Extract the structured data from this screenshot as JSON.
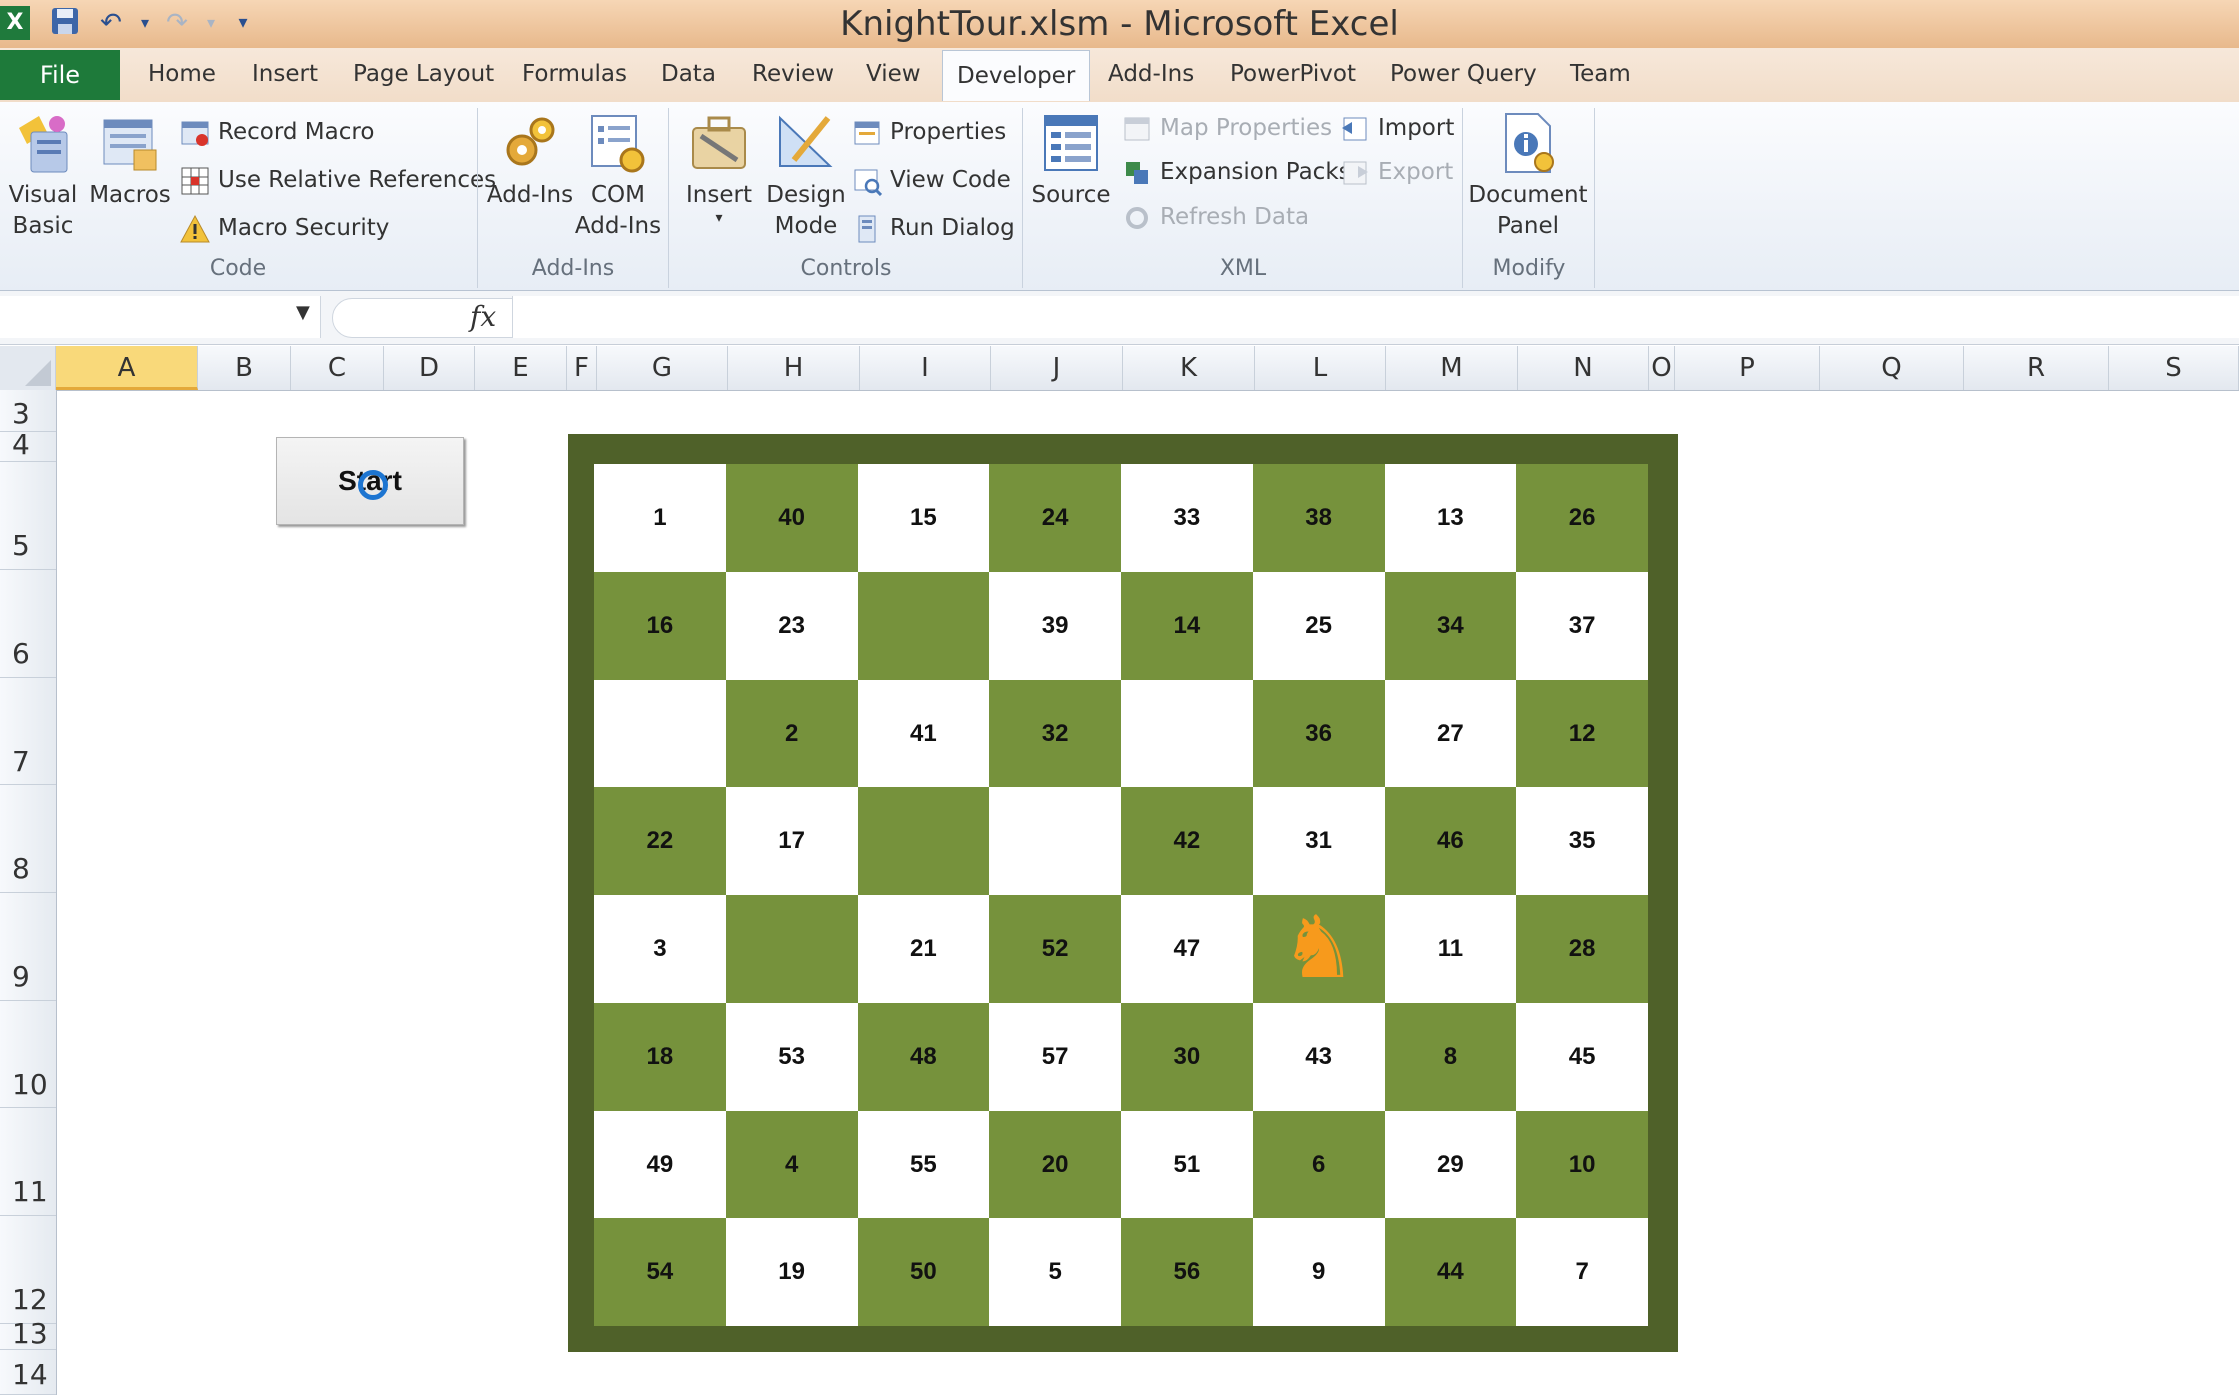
{
  "window": {
    "title": "KnightTour.xlsm  -  Microsoft Excel"
  },
  "quick_access": {
    "excel_icon": "excel-icon",
    "save_icon": "save-icon",
    "undo_icon": "undo-icon",
    "redo_icon": "redo-icon",
    "customize_icon": "customize-icon"
  },
  "tabs": [
    "File",
    "Home",
    "Insert",
    "Page Layout",
    "Formulas",
    "Data",
    "Review",
    "View",
    "Developer",
    "Add-Ins",
    "PowerPivot",
    "Power Query",
    "Team"
  ],
  "active_tab": "Developer",
  "ribbon": {
    "code": {
      "label": "Code",
      "visual_basic": [
        "Visual",
        "Basic"
      ],
      "macros": "Macros",
      "record_macro": "Record Macro",
      "use_relative": "Use Relative References",
      "macro_security": "Macro Security"
    },
    "addins": {
      "label": "Add-Ins",
      "addins": "Add-Ins",
      "com_addins": [
        "COM",
        "Add-Ins"
      ]
    },
    "controls": {
      "label": "Controls",
      "insert": "Insert",
      "design_mode": [
        "Design",
        "Mode"
      ],
      "properties": "Properties",
      "view_code": "View Code",
      "run_dialog": "Run Dialog"
    },
    "xml": {
      "label": "XML",
      "source": "Source",
      "map_properties": "Map Properties",
      "expansion_packs": "Expansion Packs",
      "refresh_data": "Refresh Data",
      "import": "Import",
      "export": "Export"
    },
    "modify": {
      "label": "Modify",
      "document_panel": [
        "Document",
        "Panel"
      ]
    }
  },
  "formula_bar": {
    "fx": "fx",
    "name_box": "",
    "formula": ""
  },
  "columns": [
    "A",
    "B",
    "C",
    "D",
    "E",
    "F",
    "G",
    "H",
    "I",
    "J",
    "K",
    "L",
    "M",
    "N",
    "O",
    "P",
    "Q",
    "R",
    "S"
  ],
  "selected_column": "A",
  "rows": [
    "3",
    "4",
    "5",
    "6",
    "7",
    "8",
    "9",
    "10",
    "11",
    "12",
    "13",
    "14"
  ],
  "start_button": {
    "label": "Start"
  },
  "board": {
    "cells": [
      [
        "1",
        "40",
        "15",
        "24",
        "33",
        "38",
        "13",
        "26"
      ],
      [
        "16",
        "23",
        "",
        "39",
        "14",
        "25",
        "34",
        "37"
      ],
      [
        "",
        "2",
        "41",
        "32",
        "",
        "36",
        "27",
        "12"
      ],
      [
        "22",
        "17",
        "",
        "",
        "42",
        "31",
        "46",
        "35"
      ],
      [
        "3",
        "",
        "21",
        "52",
        "47",
        "",
        "11",
        "28"
      ],
      [
        "18",
        "53",
        "48",
        "57",
        "30",
        "43",
        "8",
        "45"
      ],
      [
        "49",
        "4",
        "55",
        "20",
        "51",
        "6",
        "29",
        "10"
      ],
      [
        "54",
        "19",
        "50",
        "5",
        "56",
        "9",
        "44",
        "7"
      ]
    ],
    "knight_position": {
      "row": 4,
      "col": 5
    },
    "knight_icon": "knight-icon",
    "colors": {
      "dark": "#76923c",
      "light": "#ffffff",
      "frame": "#4f6129",
      "knight": "#f79a1c"
    }
  }
}
